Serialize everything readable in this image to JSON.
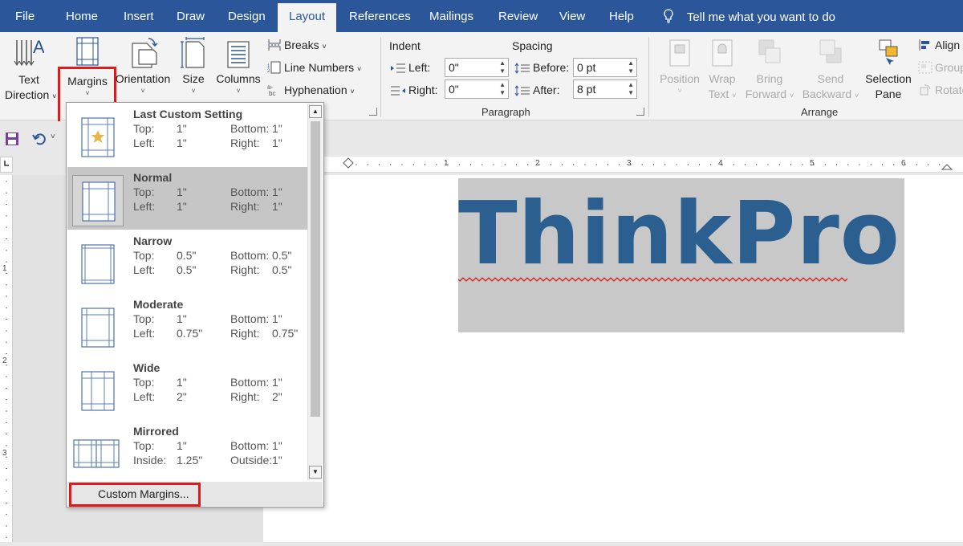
{
  "tabs": [
    "File",
    "Home",
    "Insert",
    "Draw",
    "Design",
    "Layout",
    "References",
    "Mailings",
    "Review",
    "View",
    "Help"
  ],
  "active_tab": "Layout",
  "tell_me": "Tell me what you want to do",
  "page_setup": {
    "text_direction": [
      "Text",
      "Direction"
    ],
    "margins": "Margins",
    "orientation": "Orientation",
    "size": "Size",
    "columns": "Columns",
    "breaks": "Breaks",
    "line_numbers": "Line Numbers",
    "hyphenation": "Hyphenation"
  },
  "paragraph": {
    "group_label": "Paragraph",
    "indent_label": "Indent",
    "spacing_label": "Spacing",
    "left_label": "Left:",
    "left_value": "0\"",
    "right_label": "Right:",
    "right_value": "0\"",
    "before_label": "Before:",
    "before_value": "0 pt",
    "after_label": "After:",
    "after_value": "8 pt"
  },
  "arrange": {
    "group_label": "Arrange",
    "position": "Position",
    "wrap_text": [
      "Wrap",
      "Text"
    ],
    "bring_forward": [
      "Bring",
      "Forward"
    ],
    "send_backward": [
      "Send",
      "Backward"
    ],
    "selection_pane": [
      "Selection",
      "Pane"
    ],
    "align": "Align",
    "group": "Group",
    "rotate": "Rotate"
  },
  "ruler_numbers": [
    "1",
    "2",
    "3",
    "4",
    "5",
    "6"
  ],
  "vruler_numbers": [
    "1",
    "2",
    "3"
  ],
  "document_text": "ThinkPro",
  "margins_menu": {
    "items": [
      {
        "name": "Last Custom Setting",
        "k1": "Top:",
        "v1": "1\"",
        "k2": "Bottom:",
        "v2": "1\"",
        "k3": "Left:",
        "v3": "1\"",
        "k4": "Right:",
        "v4": "1\""
      },
      {
        "name": "Normal",
        "k1": "Top:",
        "v1": "1\"",
        "k2": "Bottom:",
        "v2": "1\"",
        "k3": "Left:",
        "v3": "1\"",
        "k4": "Right:",
        "v4": "1\""
      },
      {
        "name": "Narrow",
        "k1": "Top:",
        "v1": "0.5\"",
        "k2": "Bottom:",
        "v2": "0.5\"",
        "k3": "Left:",
        "v3": "0.5\"",
        "k4": "Right:",
        "v4": "0.5\""
      },
      {
        "name": "Moderate",
        "k1": "Top:",
        "v1": "1\"",
        "k2": "Bottom:",
        "v2": "1\"",
        "k3": "Left:",
        "v3": "0.75\"",
        "k4": "Right:",
        "v4": "0.75\""
      },
      {
        "name": "Wide",
        "k1": "Top:",
        "v1": "1\"",
        "k2": "Bottom:",
        "v2": "1\"",
        "k3": "Left:",
        "v3": "2\"",
        "k4": "Right:",
        "v4": "2\""
      },
      {
        "name": "Mirrored",
        "k1": "Top:",
        "v1": "1\"",
        "k2": "Bottom:",
        "v2": "1\"",
        "k3": "Inside:",
        "v3": "1.25\"",
        "k4": "Outside:",
        "v4": "1\""
      }
    ],
    "custom_margins": "Custom Margins..."
  },
  "colors": {
    "title_bar": "#2b579a",
    "highlight_red": "#e01b1b",
    "document_text": "#2b5f8f"
  }
}
